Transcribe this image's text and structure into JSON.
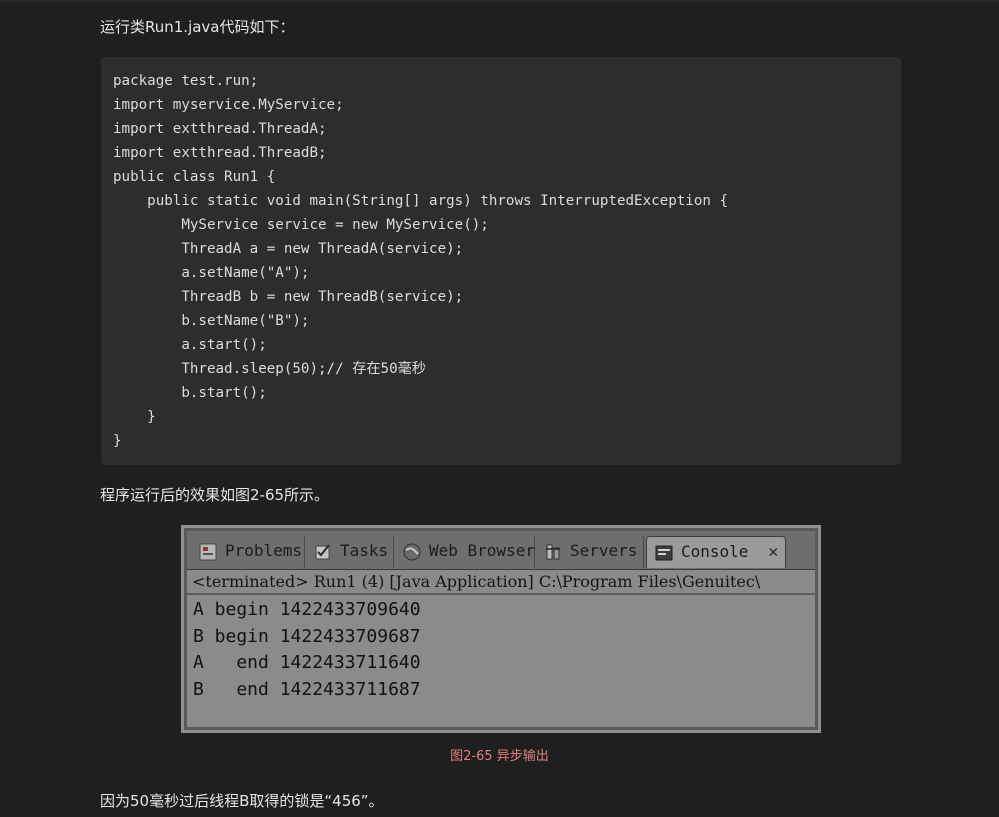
{
  "intro_text": "运行类Run1.java代码如下：",
  "code_lines": [
    "package test.run;",
    "import myservice.MyService;",
    "import extthread.ThreadA;",
    "import extthread.ThreadB;",
    "public class Run1 {",
    "    public static void main(String[] args) throws InterruptedException {",
    "        MyService service = new MyService();",
    "        ThreadA a = new ThreadA(service);",
    "        a.setName(\"A\");",
    "        ThreadB b = new ThreadB(service);",
    "        b.setName(\"B\");",
    "        a.start();",
    "        Thread.sleep(50);// 存在50毫秒",
    "        b.start();",
    "    }",
    "}"
  ],
  "result_text": "程序运行后的效果如图2-65所示。",
  "console": {
    "tabs": [
      {
        "label": "Problems",
        "icon": "problems-icon"
      },
      {
        "label": "Tasks",
        "icon": "tasks-icon"
      },
      {
        "label": "Web Browser",
        "icon": "globe-icon"
      },
      {
        "label": "Servers",
        "icon": "servers-icon"
      },
      {
        "label": "Console",
        "icon": "console-icon",
        "close": "✕"
      }
    ],
    "status": "<terminated> Run1 (4) [Java Application] C:\\Program Files\\Genuitec\\",
    "output": [
      "A begin 1422433709640",
      "B begin 1422433709687",
      "A   end 1422433711640",
      "B   end 1422433711687"
    ]
  },
  "caption": "图2-65   异步输出",
  "conclusion_text": "因为50毫秒过后线程B取得的锁是“456”。",
  "colors": {
    "background": "#1f1f1f",
    "code_background": "#2d2d2d",
    "caption": "#e08080"
  }
}
